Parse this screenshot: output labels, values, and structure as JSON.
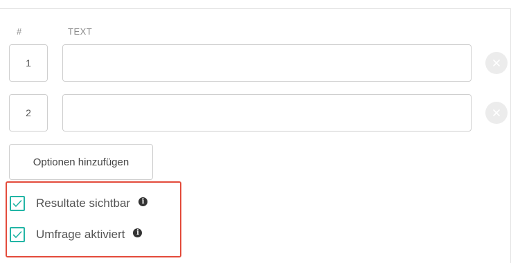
{
  "table": {
    "col_number_header": "#",
    "col_text_header": "TEXT",
    "rows": [
      {
        "number": "1",
        "text_value": ""
      },
      {
        "number": "2",
        "text_value": ""
      }
    ]
  },
  "add_options_label": "Optionen hinzufügen",
  "settings": {
    "results_visible": {
      "label": "Resultate sichtbar",
      "checked": true,
      "info_icon": "i"
    },
    "survey_activated": {
      "label": "Umfrage aktiviert",
      "checked": true,
      "info_icon": "i"
    }
  },
  "colors": {
    "accent": "#22b5a5",
    "highlight_border": "#e34b3b"
  },
  "icons": {
    "remove": "close-icon",
    "checkbox": "checkmark-icon",
    "info": "info-icon"
  }
}
